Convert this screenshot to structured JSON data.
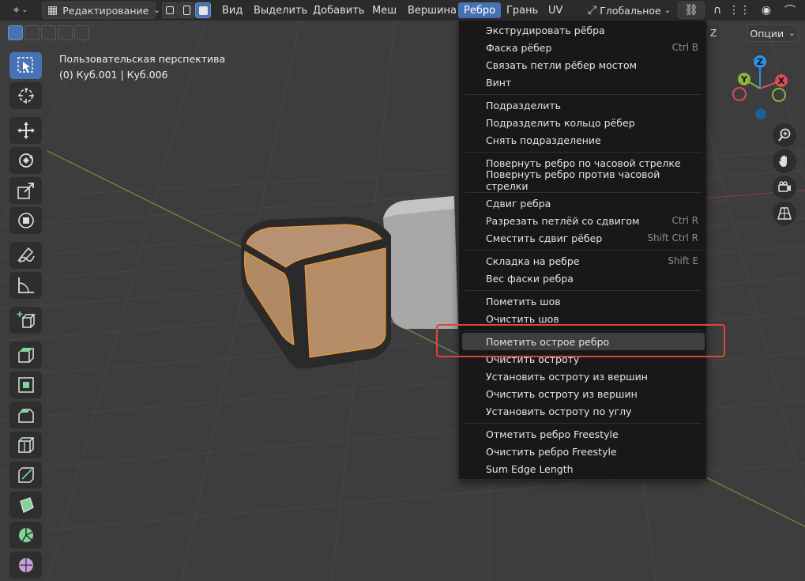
{
  "header": {
    "mode_label": "Редактирование",
    "menus": [
      "Вид",
      "Выделить",
      "Добавить",
      "Меш",
      "Вершина",
      "Ребро",
      "Грань",
      "UV"
    ],
    "active_menu": "Ребро",
    "orientation_label": "Глобальное"
  },
  "viewport": {
    "perspective_label": "Пользовательская перспектива",
    "object_label": "(0) Куб.001 | Куб.006",
    "options_label": "Опции",
    "gizmo": {
      "z": "Z",
      "y": "Y",
      "x": "X"
    }
  },
  "colors": {
    "accent": "#4772b3",
    "cube_face": "#b08a63",
    "cube_edge_selected": "#ff9d2e",
    "highlight_box": "#e0443a",
    "x_axis": "#d94d58",
    "y_axis": "#8ab53c",
    "z_axis": "#2f8fe6"
  },
  "edge_menu": {
    "items": [
      {
        "label": "Экструдировать рёбра",
        "shortcut": ""
      },
      {
        "label": "Фаска рёбер",
        "shortcut": "Ctrl B"
      },
      {
        "label": "Связать петли рёбер мостом",
        "shortcut": ""
      },
      {
        "label": "Винт",
        "shortcut": ""
      },
      {
        "label": "Подразделить",
        "shortcut": ""
      },
      {
        "label": "Подразделить кольцо рёбер",
        "shortcut": ""
      },
      {
        "label": "Снять подразделение",
        "shortcut": ""
      },
      {
        "label": "Повернуть ребро по часовой стрелке",
        "shortcut": ""
      },
      {
        "label": "Повернуть ребро против часовой стрелки",
        "shortcut": ""
      },
      {
        "label": "Сдвиг ребра",
        "shortcut": ""
      },
      {
        "label": "Разрезать петлёй со сдвигом",
        "shortcut": "Ctrl R"
      },
      {
        "label": "Сместить сдвиг рёбер",
        "shortcut": "Shift Ctrl R"
      },
      {
        "label": "Складка на ребре",
        "shortcut": "Shift E"
      },
      {
        "label": "Вес фаски ребра",
        "shortcut": ""
      },
      {
        "label": "Пометить шов",
        "shortcut": ""
      },
      {
        "label": "Очистить шов",
        "shortcut": ""
      },
      {
        "label": "Пометить острое ребро",
        "shortcut": ""
      },
      {
        "label": "Очистить остроту",
        "shortcut": ""
      },
      {
        "label": "Установить остроту из вершин",
        "shortcut": ""
      },
      {
        "label": "Очистить остроту из вершин",
        "shortcut": ""
      },
      {
        "label": "Установить остроту по углу",
        "shortcut": ""
      },
      {
        "label": "Отметить ребро Freestyle",
        "shortcut": ""
      },
      {
        "label": "Очистить ребро Freestyle",
        "shortcut": ""
      },
      {
        "label": "Sum Edge Length",
        "shortcut": ""
      }
    ],
    "highlighted_item": "Пометить острое ребро"
  },
  "icons": {
    "toolbar": [
      "select-box-icon",
      "cursor-icon",
      "move-icon",
      "rotate-icon",
      "scale-icon",
      "transform-icon",
      "annotate-icon",
      "measure-icon",
      "add-cube-icon",
      "extrude-region-icon",
      "inset-faces-icon",
      "bevel-icon",
      "loop-cut-icon",
      "knife-icon",
      "poly-build-icon",
      "spin-icon",
      "smooth-icon"
    ],
    "nav": [
      "zoom-icon",
      "pan-hand-icon",
      "camera-icon",
      "grid-view-icon"
    ]
  }
}
